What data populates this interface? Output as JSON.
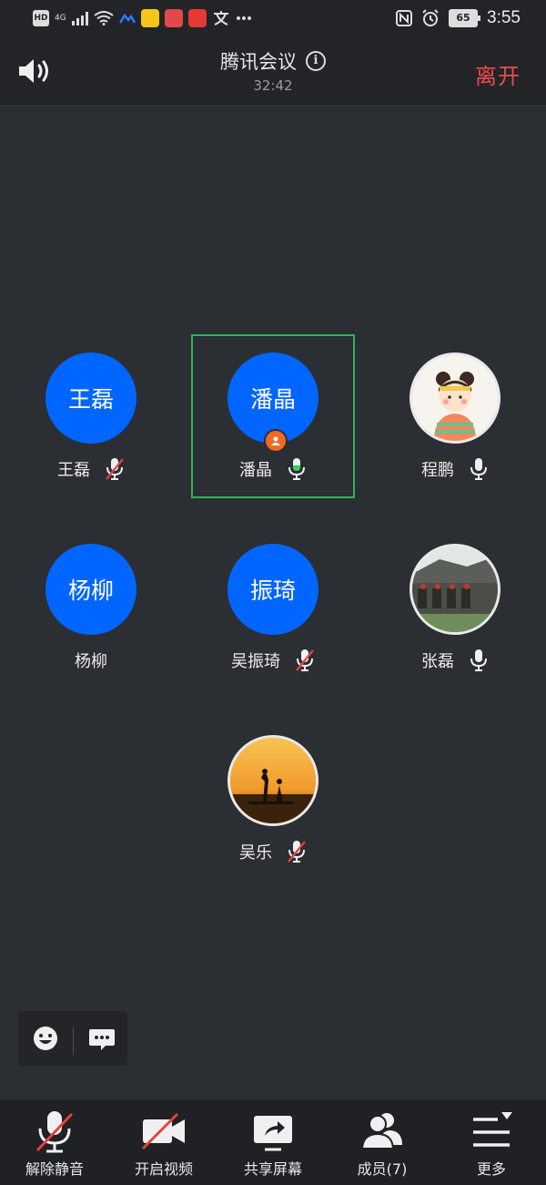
{
  "status_bar": {
    "hd_label": "HD",
    "network_label": "4G",
    "time": "3:55",
    "battery": "65",
    "icons": [
      "hd-icon",
      "signal-icon",
      "wifi-icon",
      "app-icon",
      "app-icon",
      "app-icon",
      "recorder-icon",
      "translate-icon",
      "more-dots-icon",
      "nfc-icon",
      "alarm-icon",
      "battery-icon"
    ]
  },
  "header": {
    "title": "腾讯会议",
    "timer": "32:42",
    "leave_label": "离开"
  },
  "participants": [
    {
      "avatar_text": "王磊",
      "name": "王磊",
      "mic": "muted"
    },
    {
      "avatar_text": "潘晶",
      "name": "潘晶",
      "mic": "speaking",
      "host": true
    },
    {
      "avatar_text": "",
      "name": "程鹏",
      "mic": "on",
      "avatar_type": "photo-cartoon"
    },
    {
      "avatar_text": "杨柳",
      "name": "杨柳",
      "mic": "none"
    },
    {
      "avatar_text": "振琦",
      "name": "吴振琦",
      "mic": "muted"
    },
    {
      "avatar_text": "",
      "name": "张磊",
      "mic": "on",
      "avatar_type": "photo-building"
    },
    {
      "avatar_text": "",
      "name": "吴乐",
      "mic": "muted",
      "avatar_type": "photo-sunset"
    }
  ],
  "toolbar": {
    "unmute_label": "解除静音",
    "video_label": "开启视频",
    "share_label": "共享屏幕",
    "members_label": "成员(7)",
    "more_label": "更多"
  },
  "colors": {
    "background": "#2b2e33",
    "bar": "#222428",
    "avatar_blue": "#0066ff",
    "leave_red": "#ef4b4b",
    "speaking_green": "#2fb35b",
    "mute_red": "#e84040"
  }
}
